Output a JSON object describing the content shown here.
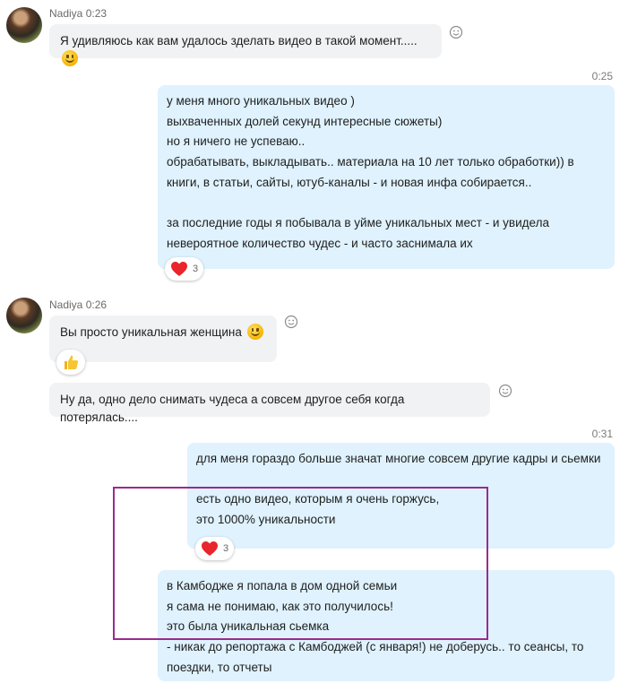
{
  "messages": {
    "m1": {
      "sender": "Nadiya",
      "time": "0:23",
      "text": "Я удивляюсь как вам удалось зделать видео в такой момент....."
    },
    "m2": {
      "time": "0:25",
      "lines": [
        "у меня много уникальных видео )",
        "выхваченных долей секунд интересные сюжеты)",
        "но я ничего не успеваю..",
        "обрабатывать, выкладывать.. материала на 10 лет только обработки)) в",
        "книги, в статьи, сайты, ютуб-каналы - и новая инфа собирается..",
        "",
        "за последние годы я побывала в уйме уникальных мест - и увидела",
        "невероятное количество чудес - и часто заснимала их"
      ],
      "reaction_count": "3"
    },
    "m3": {
      "sender": "Nadiya",
      "time": "0:26",
      "text": "Вы просто уникальная женщина"
    },
    "m4": {
      "text": "Ну да, одно дело снимать чудеса а совсем другое себя когда потерялась...."
    },
    "m5": {
      "time": "0:31",
      "lines": [
        "для меня гораздо больше значат многие совсем другие кадры и сьемки",
        "",
        "есть одно видео, которым я очень горжусь,",
        "это 1000% уникальности"
      ],
      "reaction_count": "3"
    },
    "m6": {
      "lines": [
        "в Камбодже я попала в дом одной семьи",
        "я сама не понимаю, как это получилось!",
        "это была уникальная сьемка",
        "- никак до репортажа с Камбоджей (с января!) не доберусь.. то сеансы, то",
        "поездки, то отчеты"
      ]
    }
  },
  "icons": {
    "add_reaction": "smiley-outline-icon",
    "heart": "heart-icon",
    "thumbs_up": "thumbs-up-icon",
    "emoji": "smiley-emoji-icon"
  },
  "colors": {
    "incoming_bubble": "#f1f2f4",
    "outgoing_bubble": "#dff2fd",
    "heart": "#e8262b",
    "highlight_box": "#9b2a8e"
  }
}
